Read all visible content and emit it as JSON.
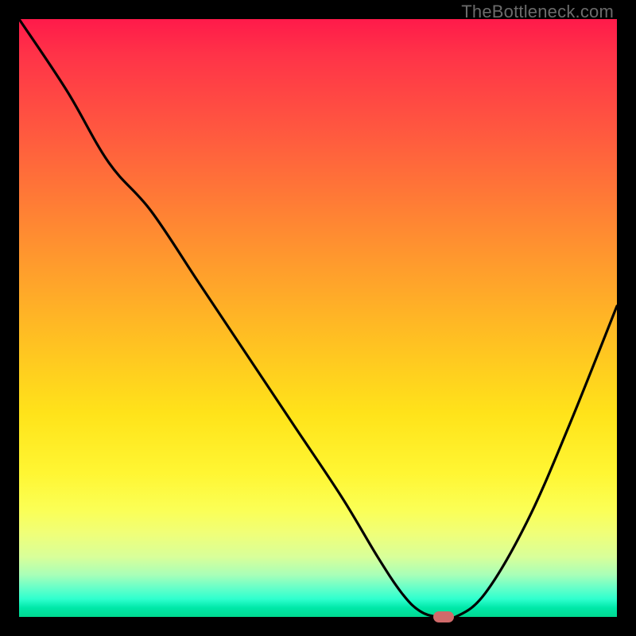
{
  "watermark": "TheBottleneck.com",
  "colors": {
    "frame_bg": "#000000",
    "curve_stroke": "#000000",
    "marker_fill": "#d06a6a"
  },
  "chart_data": {
    "type": "line",
    "title": "",
    "xlabel": "",
    "ylabel": "",
    "xlim": [
      0,
      100
    ],
    "ylim": [
      0,
      100
    ],
    "grid": false,
    "legend": false,
    "series": [
      {
        "name": "bottleneck-curve",
        "x": [
          0,
          8,
          15,
          22,
          30,
          38,
          46,
          54,
          60,
          64,
          67,
          70,
          73,
          78,
          85,
          92,
          100
        ],
        "values": [
          100,
          88,
          76,
          68,
          56,
          44,
          32,
          20,
          10,
          4,
          1,
          0,
          0,
          4,
          16,
          32,
          52
        ]
      }
    ],
    "annotations": [
      {
        "name": "optimal-marker",
        "x": 71,
        "y": 0
      }
    ],
    "gradient_scale_semantic": "top=red=severe-bottleneck, bottom=green=no-bottleneck"
  }
}
